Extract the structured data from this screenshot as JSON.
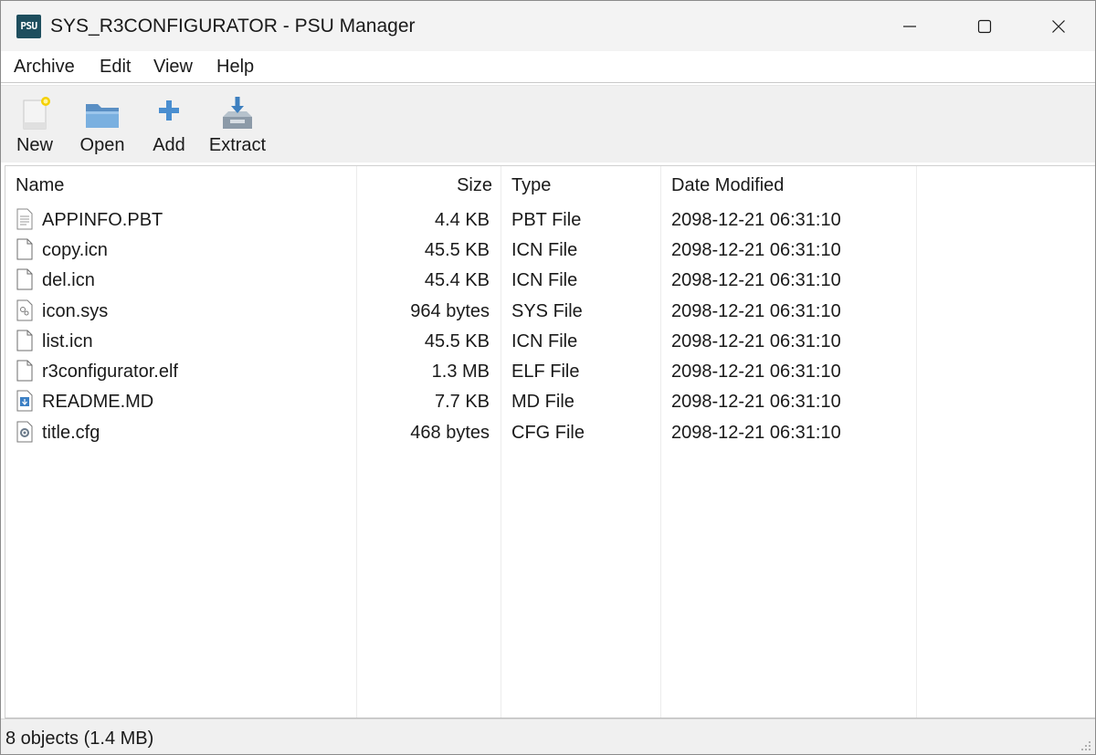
{
  "window": {
    "app_icon_text": "PSU",
    "title": "SYS_R3CONFIGURATOR - PSU Manager"
  },
  "menu": {
    "items": [
      "Archive",
      "Edit",
      "View",
      "Help"
    ]
  },
  "toolbar": {
    "items": [
      {
        "label": "New",
        "icon": "new-document-icon"
      },
      {
        "label": "Open",
        "icon": "folder-open-icon"
      },
      {
        "label": "Add",
        "icon": "plus-icon"
      },
      {
        "label": "Extract",
        "icon": "extract-tray-icon"
      }
    ]
  },
  "list": {
    "columns": [
      "Name",
      "Size",
      "Type",
      "Date Modified"
    ],
    "rows": [
      {
        "name": "APPINFO.PBT",
        "size": "4.4 KB",
        "type": "PBT File",
        "date": "2098-12-21 06:31:10",
        "icon": "text-file-icon"
      },
      {
        "name": "copy.icn",
        "size": "45.5 KB",
        "type": "ICN File",
        "date": "2098-12-21 06:31:10",
        "icon": "blank-file-icon"
      },
      {
        "name": "del.icn",
        "size": "45.4 KB",
        "type": "ICN File",
        "date": "2098-12-21 06:31:10",
        "icon": "blank-file-icon"
      },
      {
        "name": "icon.sys",
        "size": "964 bytes",
        "type": "SYS File",
        "date": "2098-12-21 06:31:10",
        "icon": "system-file-icon"
      },
      {
        "name": "list.icn",
        "size": "45.5 KB",
        "type": "ICN File",
        "date": "2098-12-21 06:31:10",
        "icon": "blank-file-icon"
      },
      {
        "name": "r3configurator.elf",
        "size": "1.3 MB",
        "type": "ELF File",
        "date": "2098-12-21 06:31:10",
        "icon": "blank-file-icon"
      },
      {
        "name": "README.MD",
        "size": "7.7 KB",
        "type": "MD File",
        "date": "2098-12-21 06:31:10",
        "icon": "markdown-file-icon"
      },
      {
        "name": "title.cfg",
        "size": "468 bytes",
        "type": "CFG File",
        "date": "2098-12-21 06:31:10",
        "icon": "config-file-icon"
      }
    ]
  },
  "status": {
    "text": "8 objects (1.4 MB)"
  },
  "colors": {
    "titlebar_bg": "#f3f3f3",
    "toolbar_bg": "#f0f0f0",
    "app_icon_bg": "#1e4e5e",
    "accent_blue": "#3b7fc4"
  }
}
